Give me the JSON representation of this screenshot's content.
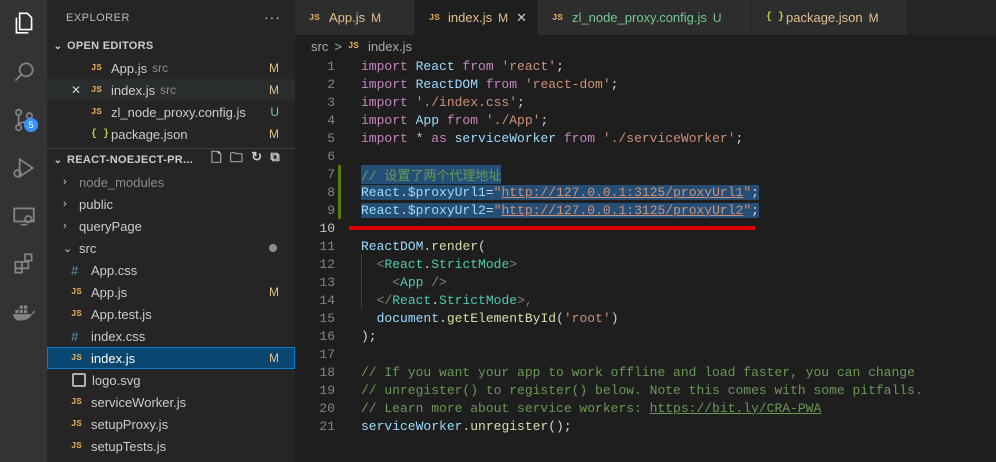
{
  "explorer": {
    "title": "EXPLORER",
    "more": "···",
    "open_editors_title": "OPEN EDITORS",
    "open_editors": [
      {
        "icon": "JS",
        "name": "App.js",
        "desc": "src",
        "badge": "M",
        "close": ""
      },
      {
        "icon": "JS",
        "name": "index.js",
        "desc": "src",
        "badge": "M",
        "close": "✕"
      },
      {
        "icon": "JS",
        "name": "zl_node_proxy.config.js",
        "desc": "",
        "badge": "U",
        "close": ""
      },
      {
        "icon": "{ }",
        "name": "package.json",
        "desc": "",
        "badge": "M",
        "close": ""
      }
    ],
    "project_title": "REACT-NOEJECT-PR...",
    "tree": [
      {
        "name": "node_modules"
      },
      {
        "name": "public"
      },
      {
        "name": "queryPage"
      },
      {
        "name": "src"
      },
      {
        "icon": "#",
        "name": "App.css",
        "badge": ""
      },
      {
        "icon": "JS",
        "name": "App.js",
        "badge": "M"
      },
      {
        "icon": "JS",
        "name": "App.test.js",
        "badge": ""
      },
      {
        "icon": "#",
        "name": "index.css",
        "badge": ""
      },
      {
        "icon": "JS",
        "name": "index.js",
        "badge": "M"
      },
      {
        "icon": "",
        "name": "logo.svg",
        "badge": ""
      },
      {
        "icon": "JS",
        "name": "serviceWorker.js",
        "badge": ""
      },
      {
        "icon": "JS",
        "name": "setupProxy.js",
        "badge": ""
      },
      {
        "icon": "JS",
        "name": "setupTests.js",
        "badge": ""
      }
    ]
  },
  "scm_badge": "5",
  "tabs": [
    {
      "icon": "JS",
      "name": "App.js",
      "mark": "M",
      "close": ""
    },
    {
      "icon": "JS",
      "name": "index.js",
      "mark": "M",
      "close": "✕"
    },
    {
      "icon": "JS",
      "name": "zl_node_proxy.config.js",
      "mark": "U",
      "close": ""
    },
    {
      "icon": "{ }",
      "name": "package.json",
      "mark": "M",
      "close": ""
    }
  ],
  "breadcrumb": {
    "folder": "src",
    "sep": ">",
    "icon": "JS",
    "file": "index.js"
  },
  "line_numbers": [
    "1",
    "2",
    "3",
    "4",
    "5",
    "6",
    "7",
    "8",
    "9",
    "10",
    "11",
    "12",
    "13",
    "14",
    "15",
    "16",
    "17",
    "18",
    "19",
    "20",
    "21"
  ],
  "code": {
    "l1": [
      "import",
      " React ",
      "from",
      " 'react'",
      ";"
    ],
    "l2": [
      "import",
      " ReactDOM ",
      "from",
      " 'react-dom'",
      ";"
    ],
    "l3": [
      "import",
      " './index.css'",
      ";"
    ],
    "l4": [
      "import",
      " App ",
      "from",
      " './App'",
      ";"
    ],
    "l5": [
      "import",
      " * ",
      "as",
      " serviceWorker ",
      "from",
      " './serviceWorker'",
      ";"
    ],
    "l7": "// 设置了两个代理地址",
    "l8": [
      "React",
      ".",
      "$proxyUrl1",
      "=",
      "\"",
      "http://127.0.0.1:3125/proxyUrl1",
      "\"",
      ";"
    ],
    "l9": [
      "React",
      ".",
      "$proxyUrl2",
      "=",
      "\"",
      "http://127.0.0.1:3125/proxyUrl2",
      "\"",
      ";"
    ],
    "l11": [
      "ReactDOM",
      ".",
      "render",
      "("
    ],
    "l12": [
      "  <",
      "React",
      ".",
      "StrictMode",
      ">"
    ],
    "l13": [
      "    <",
      "App",
      " />"
    ],
    "l14": [
      "  </",
      "React",
      ".",
      "StrictMode",
      ">,"
    ],
    "l15": [
      "  ",
      "document",
      ".",
      "getElementById",
      "(",
      "'root'",
      ")"
    ],
    "l16": [
      ");"
    ],
    "l18": "// If you want your app to work offline and load faster, you can change",
    "l19": "// unregister() to register() below. Note this comes with some pitfalls.",
    "l20": [
      "// Learn more about service workers: ",
      "https://bit.ly/CRA-PWA"
    ],
    "l21": [
      "serviceWorker",
      ".",
      "unregister",
      "();"
    ]
  },
  "colors": {
    "modified": "#e2c08d",
    "untracked": "#73c991",
    "annotation": "#e00000"
  }
}
